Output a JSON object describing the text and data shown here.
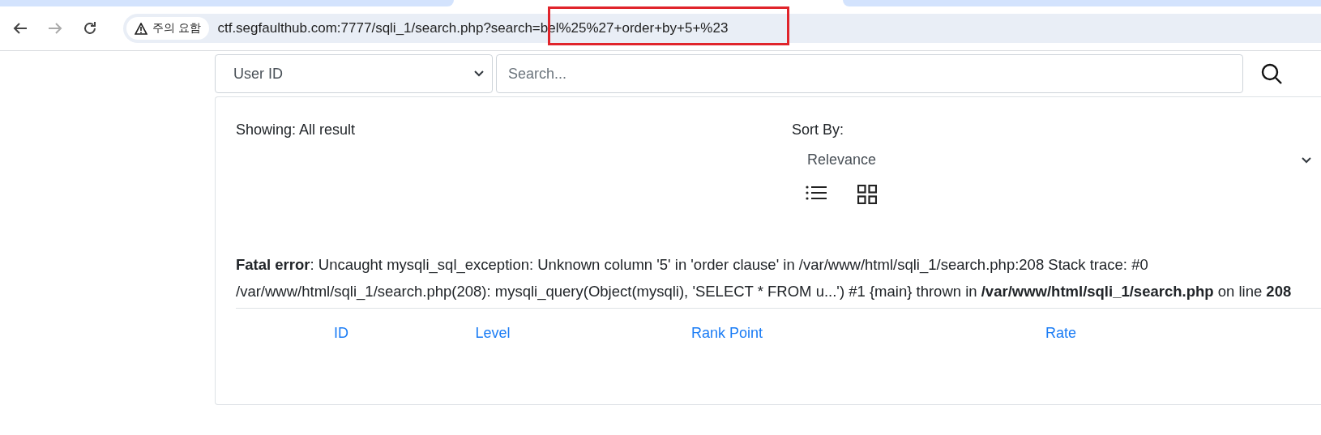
{
  "browser": {
    "security_chip": "주의 요함",
    "url": "ctf.segfaulthub.com:7777/sqli_1/search.php?search=bel%25%27+order+by+5+%23"
  },
  "search": {
    "filter": "User ID",
    "placeholder": "Search..."
  },
  "results": {
    "showing": "Showing: All result",
    "sort_label": "Sort By:",
    "sort_value": "Relevance",
    "error_message": [
      {
        "text": "Fatal error",
        "bold": true
      },
      {
        "text": ": Uncaught mysqli_sql_exception: Unknown column '5' in 'order clause' in /var/www/html/sqli_1/search.php:208 Stack trace: #0 /var/www/html/sqli_1/search.php(208): mysqli_query(Object(mysqli), 'SELECT * FROM u...') #1 {main} thrown in ",
        "bold": false
      },
      {
        "text": "/var/www/html/sqli_1/search.php",
        "bold": true
      },
      {
        "text": " on line ",
        "bold": false
      },
      {
        "text": "208",
        "bold": true
      }
    ],
    "columns": [
      "ID",
      "Level",
      "Rank Point",
      "Rate"
    ]
  }
}
